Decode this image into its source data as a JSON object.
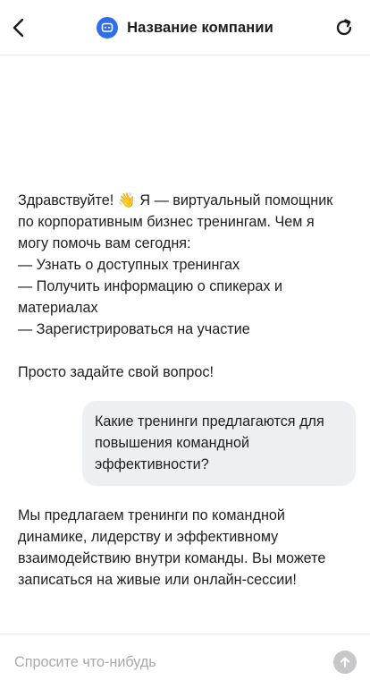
{
  "header": {
    "title": "Название компании",
    "back_icon": "chevron-left-icon",
    "refresh_icon": "refresh-icon",
    "logo_icon": "chat-bot-icon",
    "logo_color": "#2f6ee8"
  },
  "messages": [
    {
      "role": "assistant",
      "lines": [
        "Здравствуйте! 👋 Я — виртуальный помощник",
        "по корпоративным бизнес тренингам. Чем я",
        "могу помочь вам сегодня:",
        "— Узнать о доступных тренингах",
        "— Получить информацию о спикерах и",
        "материалах",
        "— Зарегистрироваться на участие",
        "",
        "Просто задайте свой вопрос!"
      ]
    },
    {
      "role": "user",
      "lines": [
        "Какие тренинги предлагаются для",
        "повышения командной",
        "эффективности?"
      ]
    },
    {
      "role": "assistant",
      "lines": [
        "Мы предлагаем тренинги по командной",
        "динамике, лидерству и эффективному",
        "взаимодействию внутри команды. Вы можете",
        "записаться на живые или онлайн-сессии!"
      ]
    }
  ],
  "composer": {
    "placeholder": "Спросите что-нибудь",
    "value": "",
    "send_icon": "arrow-up-icon",
    "send_color": "#c7c7c9"
  },
  "colors": {
    "user_bubble": "#edf0f3",
    "text": "#1e1e1e",
    "divider": "#ececec"
  }
}
